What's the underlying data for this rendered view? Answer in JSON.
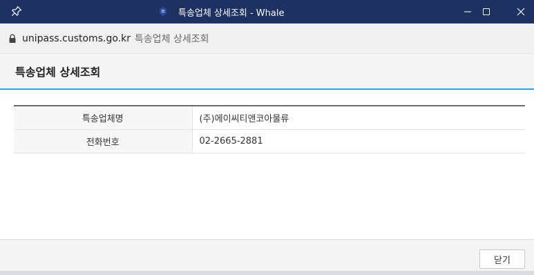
{
  "window": {
    "title": "특송업체 상세조회 - Whale",
    "colors": {
      "titlebar": "#1d3162",
      "accent": "#2ea0e8"
    }
  },
  "address_bar": {
    "domain": "unipass.customs.go.kr",
    "page_title": "특송업체 상세조회"
  },
  "page": {
    "title": "특송업체 상세조회"
  },
  "details": {
    "rows": [
      {
        "label": "특송업체명",
        "value": "(주)에이씨티앤코아물류"
      },
      {
        "label": "전화번호",
        "value": "02-2665-2881"
      }
    ]
  },
  "footer": {
    "close_label": "닫기"
  },
  "icons": [
    "pin-icon",
    "whale-app-icon",
    "minimize-icon",
    "maximize-icon",
    "close-icon",
    "lock-icon"
  ]
}
